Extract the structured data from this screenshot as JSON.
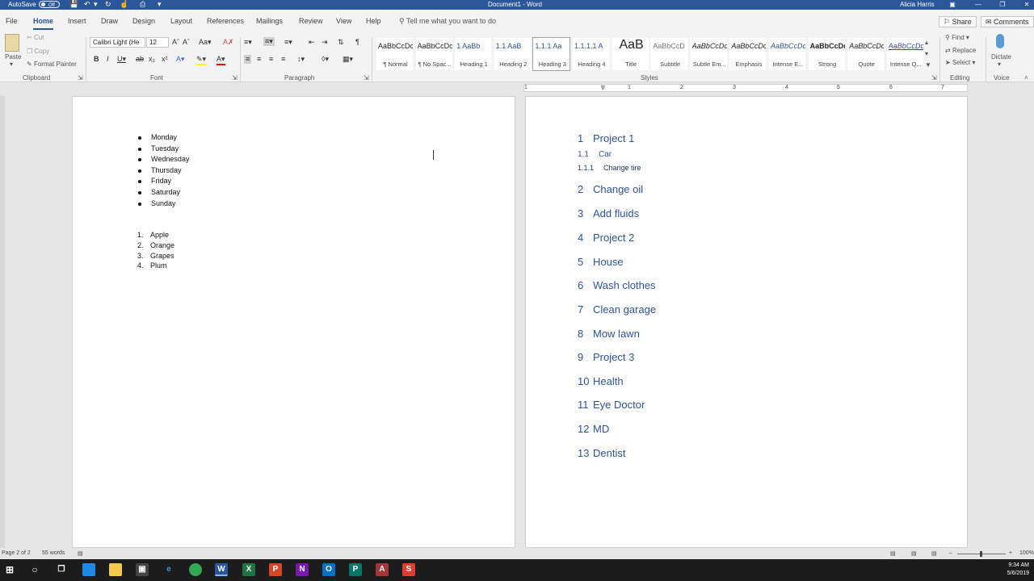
{
  "window": {
    "autosave_label": "AutoSave",
    "autosave_state": "Off",
    "title": "Document1 - Word",
    "user": "Alicia Harris"
  },
  "ribbon": {
    "tabs": [
      "File",
      "Home",
      "Insert",
      "Draw",
      "Design",
      "Layout",
      "References",
      "Mailings",
      "Review",
      "View",
      "Help"
    ],
    "active_tab": "Home",
    "tell_me": "Tell me what you want to do",
    "share": "Share",
    "comments": "Comments",
    "clipboard": {
      "paste": "Paste",
      "cut": "Cut",
      "copy": "Copy",
      "format_painter": "Format Painter",
      "group": "Clipboard"
    },
    "font": {
      "name": "Calibri Light (He",
      "size": "12",
      "group": "Font"
    },
    "paragraph": {
      "group": "Paragraph"
    },
    "styles": {
      "group": "Styles",
      "items": [
        {
          "sample": "AaBbCcDc",
          "name": "¶ Normal"
        },
        {
          "sample": "AaBbCcDc",
          "name": "¶ No Spac..."
        },
        {
          "sample": "1 AaBb",
          "name": "Heading 1"
        },
        {
          "sample": "1.1 AaB",
          "name": "Heading 2"
        },
        {
          "sample": "1.1.1 Aa",
          "name": "Heading 3"
        },
        {
          "sample": "1.1.1.1 A",
          "name": "Heading 4"
        },
        {
          "sample": "AaB",
          "name": "Title"
        },
        {
          "sample": "AaBbCcD",
          "name": "Subtitle"
        },
        {
          "sample": "AaBbCcDc",
          "name": "Subtle Em..."
        },
        {
          "sample": "AaBbCcDc",
          "name": "Emphasis"
        },
        {
          "sample": "AaBbCcDc",
          "name": "Intense E..."
        },
        {
          "sample": "AaBbCcDc",
          "name": "Strong"
        },
        {
          "sample": "AaBbCcDc",
          "name": "Quote"
        },
        {
          "sample": "AaBbCcDc",
          "name": "Intense Q..."
        }
      ]
    },
    "editing": {
      "find": "Find",
      "replace": "Replace",
      "select": "Select",
      "group": "Editing"
    },
    "voice": {
      "dictate": "Dictate",
      "group": "Voice"
    }
  },
  "ruler": {
    "numbers": [
      "1",
      "1",
      "2",
      "3",
      "4",
      "5",
      "6",
      "7"
    ]
  },
  "page1": {
    "bullets": [
      "Monday",
      "Tuesday",
      "Wednesday",
      "Thursday",
      "Friday",
      "Saturday",
      "Sunday"
    ],
    "numbered": [
      {
        "n": "1.",
        "text": "Apple"
      },
      {
        "n": "2.",
        "text": "Orange"
      },
      {
        "n": "3.",
        "text": "Grapes"
      },
      {
        "n": "4.",
        "text": "Plum"
      }
    ]
  },
  "page2": {
    "headings": [
      {
        "n": "1",
        "text": "Project 1",
        "level": 1
      },
      {
        "n": "1.1",
        "text": "Car",
        "level": 2
      },
      {
        "n": "1.1.1",
        "text": "Change tire",
        "level": 3
      },
      {
        "n": "2",
        "text": "Change oil",
        "level": 1
      },
      {
        "n": "3",
        "text": "Add fluids",
        "level": 1
      },
      {
        "n": "4",
        "text": "Project 2",
        "level": 1
      },
      {
        "n": "5",
        "text": "House",
        "level": 1
      },
      {
        "n": "6",
        "text": "Wash clothes",
        "level": 1
      },
      {
        "n": "7",
        "text": "Clean garage",
        "level": 1
      },
      {
        "n": "8",
        "text": "Mow lawn",
        "level": 1
      },
      {
        "n": "9",
        "text": "Project 3",
        "level": 1
      },
      {
        "n": "10",
        "text": "Health",
        "level": 1
      },
      {
        "n": "11",
        "text": "Eye Doctor",
        "level": 1
      },
      {
        "n": "12",
        "text": "MD",
        "level": 1
      },
      {
        "n": "13",
        "text": "Dentist",
        "level": 1
      }
    ]
  },
  "status": {
    "page": "Page 2 of 2",
    "words": "55 words",
    "zoom": "100%"
  },
  "taskbar": {
    "time": "9:34 AM",
    "date": "5/6/2019"
  },
  "colors": {
    "word_blue": "#2b579a",
    "heading": "#2f5496"
  }
}
